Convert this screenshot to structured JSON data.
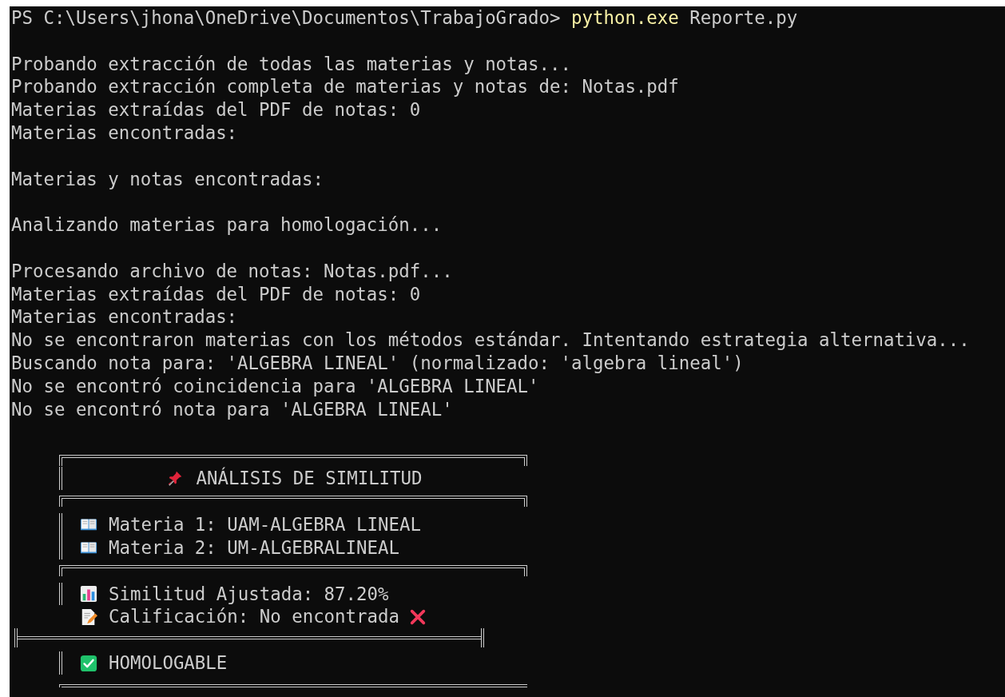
{
  "prompt": {
    "path": "PS C:\\Users\\jhona\\OneDrive\\Documentos\\TrabajoGrado>",
    "command": "python.exe",
    "argument": "Reporte.py"
  },
  "output_blocks": [
    [
      "Probando extracción de todas las materias y notas...",
      "Probando extracción completa de materias y notas de: Notas.pdf",
      "Materias extraídas del PDF de notas: 0",
      "Materias encontradas:"
    ],
    [
      "Materias y notas encontradas:"
    ],
    [
      "Analizando materias para homologación..."
    ],
    [
      "Procesando archivo de notas: Notas.pdf...",
      "Materias extraídas del PDF de notas: 0",
      "Materias encontradas:",
      "No se encontraron materias con los métodos estándar. Intentando estrategia alternativa...",
      "Buscando nota para: 'ALGEBRA LINEAL' (normalizado: 'algebra lineal')",
      "No se encontró coincidencia para 'ALGEBRA LINEAL'",
      "No se encontró nota para 'ALGEBRA LINEAL'"
    ]
  ],
  "summary_box": {
    "title": "ANÁLISIS DE SIMILITUD",
    "sections": [
      {
        "lines": [
          "Materia 1: UAM-ALGEBRA LINEAL",
          "Materia 2: UM-ALGEBRALINEAL"
        ]
      },
      {
        "lines": [
          "Similitud Ajustada: 87.20%",
          "Calificación: No encontrada"
        ]
      },
      {
        "lines": [
          "HOMOLOGABLE"
        ]
      }
    ]
  }
}
